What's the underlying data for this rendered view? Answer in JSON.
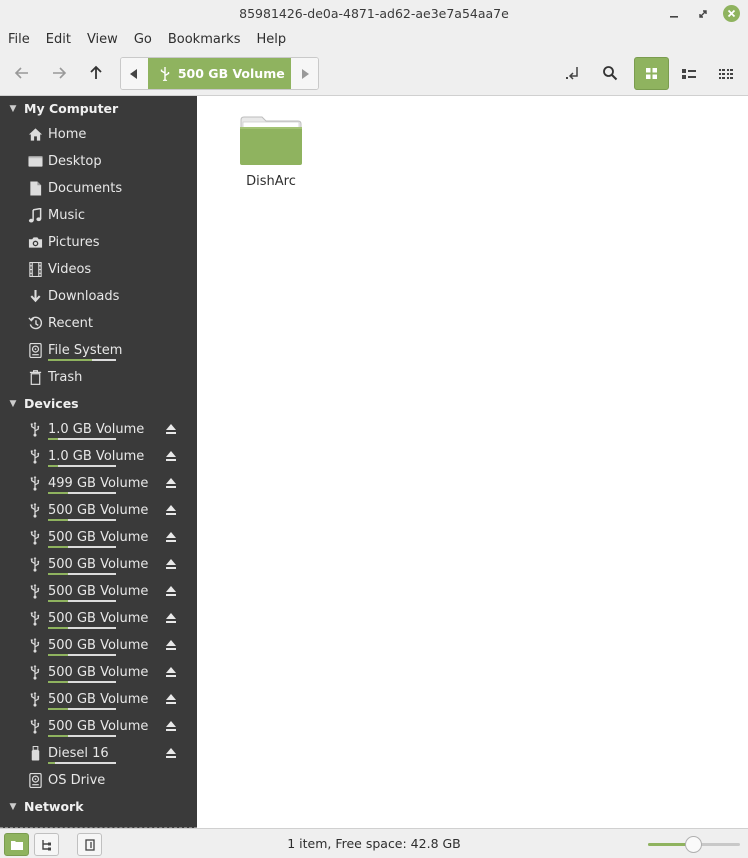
{
  "window": {
    "title": "85981426-de0a-4871-ad62-ae3e7a54aa7e"
  },
  "menu": [
    "File",
    "Edit",
    "View",
    "Go",
    "Bookmarks",
    "Help"
  ],
  "pathbar": {
    "current": "500 GB Volume"
  },
  "sidebar": {
    "sections": [
      {
        "title": "My Computer",
        "items": [
          {
            "label": "Home",
            "icon": "home-icon"
          },
          {
            "label": "Desktop",
            "icon": "desktop-icon"
          },
          {
            "label": "Documents",
            "icon": "document-icon"
          },
          {
            "label": "Music",
            "icon": "music-icon"
          },
          {
            "label": "Pictures",
            "icon": "camera-icon"
          },
          {
            "label": "Videos",
            "icon": "film-icon"
          },
          {
            "label": "Downloads",
            "icon": "download-icon"
          },
          {
            "label": "Recent",
            "icon": "recent-icon"
          },
          {
            "label": "File System",
            "icon": "drive-icon",
            "usage": 0.65
          },
          {
            "label": "Trash",
            "icon": "trash-icon"
          }
        ]
      },
      {
        "title": "Devices",
        "items": [
          {
            "label": "1.0 GB Volume",
            "icon": "usb-icon",
            "usage": 0.15,
            "eject": true
          },
          {
            "label": "1.0 GB Volume",
            "icon": "usb-icon",
            "usage": 0.15,
            "eject": true
          },
          {
            "label": "499 GB Volume",
            "icon": "usb-icon",
            "usage": 0.3,
            "eject": true
          },
          {
            "label": "500 GB Volume",
            "icon": "usb-icon",
            "usage": 0.3,
            "eject": true
          },
          {
            "label": "500 GB Volume",
            "icon": "usb-icon",
            "usage": 0.3,
            "eject": true
          },
          {
            "label": "500 GB Volume",
            "icon": "usb-icon",
            "usage": 0.3,
            "eject": true
          },
          {
            "label": "500 GB Volume",
            "icon": "usb-icon",
            "usage": 0.3,
            "eject": true
          },
          {
            "label": "500 GB Volume",
            "icon": "usb-icon",
            "usage": 0.3,
            "eject": true
          },
          {
            "label": "500 GB Volume",
            "icon": "usb-icon",
            "usage": 0.3,
            "eject": true
          },
          {
            "label": "500 GB Volume",
            "icon": "usb-icon",
            "usage": 0.3,
            "eject": true
          },
          {
            "label": "500 GB Volume",
            "icon": "usb-icon",
            "usage": 0.3,
            "eject": true
          },
          {
            "label": "500 GB Volume",
            "icon": "usb-icon",
            "usage": 0.3,
            "eject": true
          },
          {
            "label": "Diesel 16",
            "icon": "usb-stick-icon",
            "usage": 0.1,
            "eject": true
          },
          {
            "label": "OS Drive",
            "icon": "drive-icon"
          }
        ]
      },
      {
        "title": "Network",
        "items": []
      }
    ]
  },
  "files": [
    {
      "name": "DishArc",
      "icon": "folder-icon"
    }
  ],
  "status": {
    "text": "1 item, Free space: 42.8 GB",
    "zoom": 0.5
  },
  "colors": {
    "accent": "#8fb35f",
    "sidebar_bg": "#3a3a3a",
    "chrome_bg": "#efefef"
  }
}
